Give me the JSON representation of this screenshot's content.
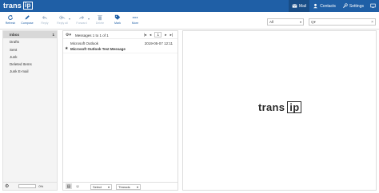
{
  "brand": {
    "word": "trans",
    "boxed": "ip"
  },
  "topnav": [
    {
      "label": "Mail",
      "icon": "mail-icon",
      "active": true
    },
    {
      "label": "Contacts",
      "icon": "contacts-icon",
      "active": false
    },
    {
      "label": "Settings",
      "icon": "settings-icon",
      "active": false
    },
    {
      "label": "",
      "icon": "monitor-icon",
      "active": false
    }
  ],
  "toolbar": {
    "refresh": "Refresh",
    "compose": "Compose",
    "reply": "Reply",
    "reply_all": "Reply all",
    "forward": "Forward",
    "delete": "Delete",
    "mark": "Mark",
    "more": "More"
  },
  "filter": {
    "selected": "All"
  },
  "search": {
    "prefix": "Q▾"
  },
  "folders": [
    {
      "name": "Inbox",
      "count": "1",
      "active": true
    },
    {
      "name": "Drafts",
      "count": ""
    },
    {
      "name": "Sent",
      "count": ""
    },
    {
      "name": "Junk",
      "count": ""
    },
    {
      "name": "Deleted Items",
      "count": ""
    },
    {
      "name": "Junk E-mail",
      "count": ""
    }
  ],
  "quota": {
    "text": "0%"
  },
  "message_list": {
    "count_text": "Messages 1 to 1 of 1",
    "page": "1",
    "messages": [
      {
        "from": "Microsoft Outlook",
        "date": "2019-05-07 12:11",
        "subject": "Microsoft Outlook Test Message"
      }
    ],
    "select_label": "Select",
    "threads_label": "Threads"
  },
  "colors": {
    "accent": "#1f5fa6",
    "accent_dark": "#184d87"
  }
}
